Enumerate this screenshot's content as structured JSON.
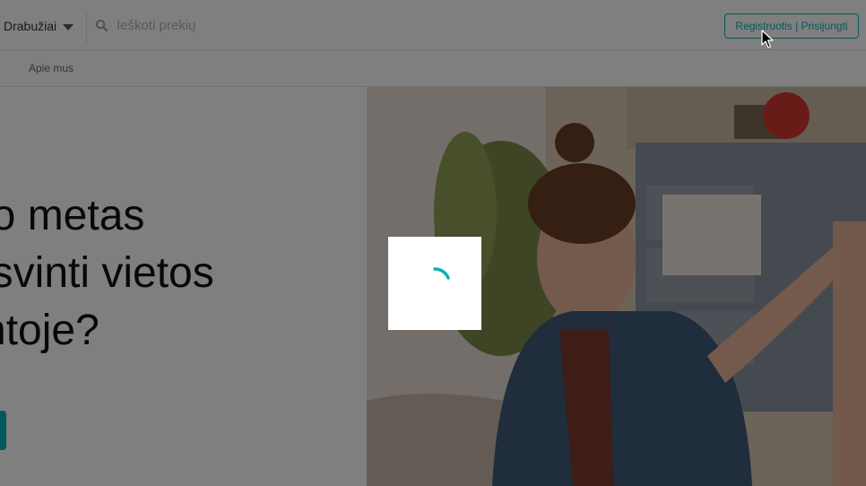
{
  "header": {
    "category_label": "Drabužiai",
    "search_placeholder": "Ieškoti prekių",
    "auth_button_label": "Registruotis | Prisijungti"
  },
  "subnav": {
    "about_label": "Apie mus"
  },
  "hero": {
    "title_lines": [
      "jo metas",
      "isvinti vietos",
      "ntoje?"
    ]
  },
  "colors": {
    "brand": "#09b1ba",
    "overlay": "rgba(0,0,0,0.5)"
  },
  "icons": [
    "chevron-down-icon",
    "search-icon",
    "loading-spinner-icon",
    "mouse-cursor-icon"
  ]
}
